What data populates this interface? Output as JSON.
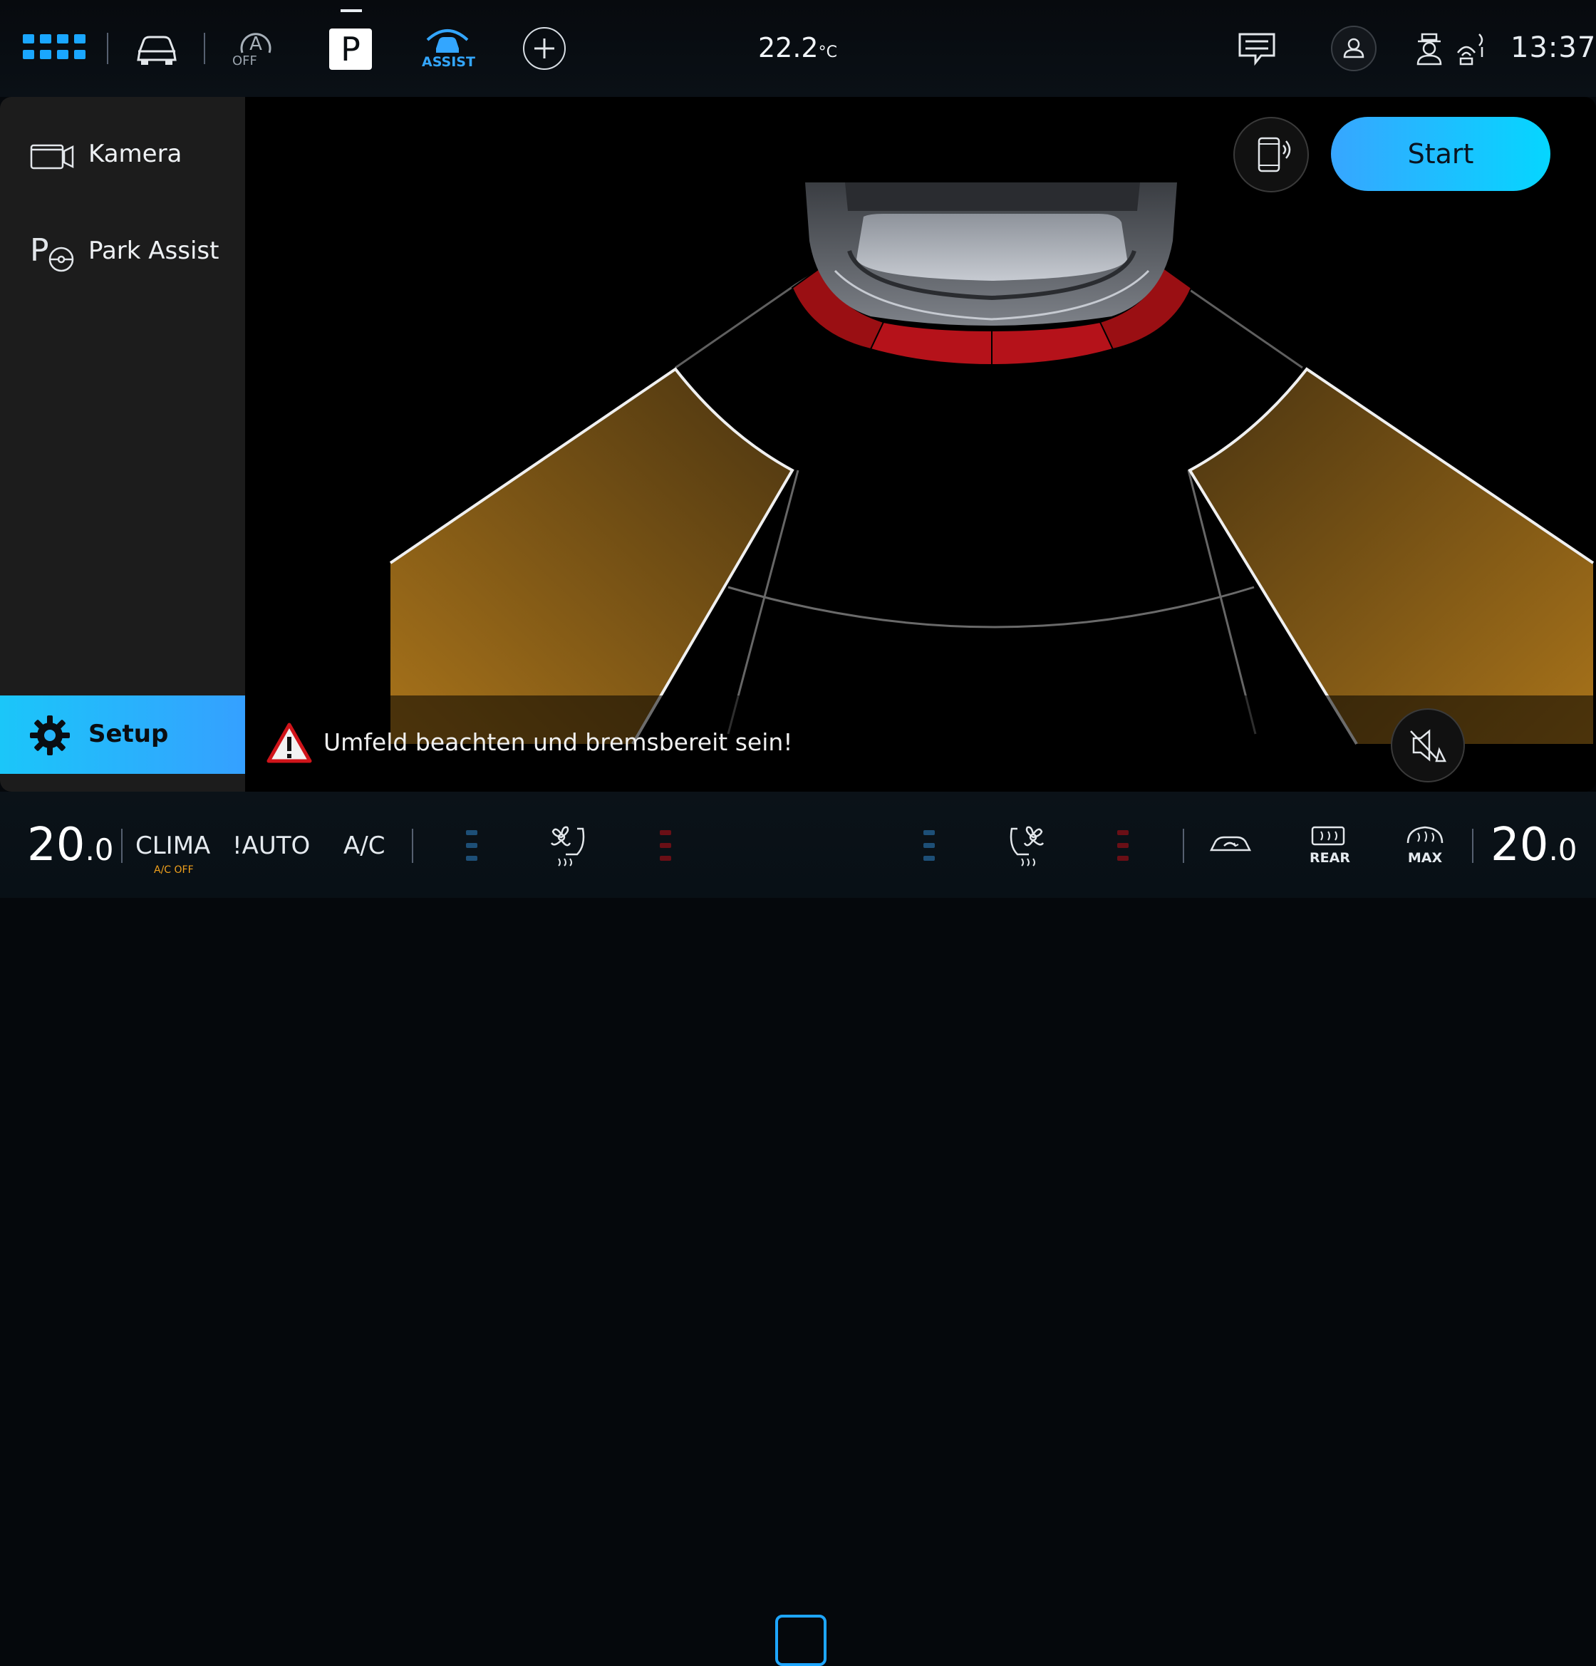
{
  "status_bar": {
    "icons": [
      "apps-grid-icon",
      "car-icon",
      "auto-hold-icon",
      "parking-p-icon",
      "park-assist-icon",
      "add-icon",
      "message-icon",
      "profile-icon",
      "driver-icon",
      "connectivity-icon"
    ],
    "auto_hold_label": "OFF",
    "gear": "P",
    "assist_label": "ASSIST",
    "outside_temp": "22.2",
    "outside_temp_unit": "°C",
    "time": "13:37"
  },
  "sidebar": {
    "items": [
      {
        "label": "Kamera",
        "icon": "camera-icon"
      },
      {
        "label": "Park Assist",
        "icon": "park-assist-steering-icon"
      }
    ],
    "setup_label": "Setup"
  },
  "park_view": {
    "start_label": "Start",
    "warning": "Umfeld beachten und bremsbereit sein!",
    "colors": {
      "front_sensor": "#c0141a",
      "side_zone": "#a8731a",
      "accent": "#1aa7ff"
    }
  },
  "climate": {
    "left_temp_int": "20",
    "left_temp_dec": ".0",
    "clima_label": "CLIMA",
    "ac_off_label": "A/C OFF",
    "auto_label": "!AUTO",
    "ac_label": "A/C",
    "rear_label": "REAR",
    "max_label": "MAX",
    "right_temp_int": "20",
    "right_temp_dec": ".0"
  }
}
